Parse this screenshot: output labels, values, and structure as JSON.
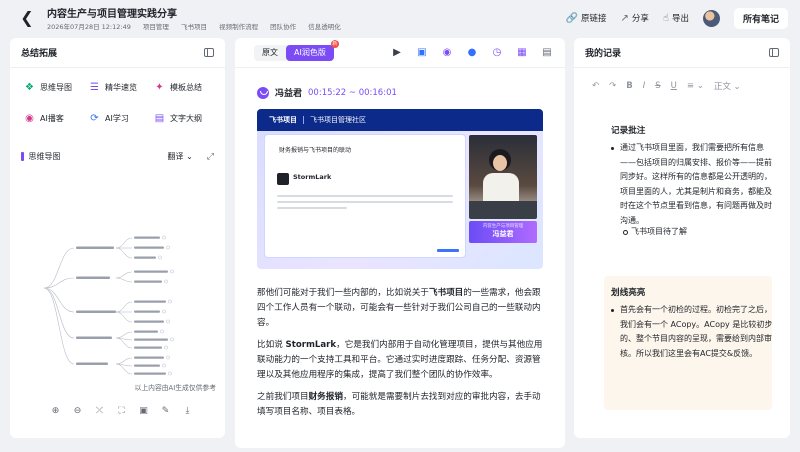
{
  "header": {
    "back_icon": "chevron-left-icon",
    "title": "内容生产与项目管理实践分享",
    "date": "2026年07月28日 12:12:49",
    "tags": [
      "项目管理",
      "飞书项目",
      "视频制作流程",
      "团队协作",
      "信息透明化"
    ],
    "actions": {
      "original_link": "原链接",
      "share": "分享",
      "export": "导出",
      "all_notes": "所有笔记"
    }
  },
  "left_panel": {
    "title": "总结拓展",
    "tools": [
      {
        "label": "思维导图",
        "icon": "mindmap-icon",
        "color": "#00a870"
      },
      {
        "label": "精华速览",
        "icon": "highlights-icon",
        "color": "#7b4cf6"
      },
      {
        "label": "模板总结",
        "icon": "template-icon",
        "color": "#d4368a"
      },
      {
        "label": "AI播客",
        "icon": "podcast-icon",
        "color": "#d4368a"
      },
      {
        "label": "AI学习",
        "icon": "ai-learn-icon",
        "color": "#3370ff"
      },
      {
        "label": "文字大纲",
        "icon": "outline-icon",
        "color": "#7b4cf6"
      }
    ],
    "mindmap": {
      "title": "思维导图",
      "translate": "翻译",
      "caption": "以上内容由AI生成仅供参考"
    }
  },
  "middle_panel": {
    "tabs": {
      "original": "原文",
      "ai_polished": "AI润色版",
      "badge": "新"
    },
    "speaker": {
      "name": "冯益君",
      "time": "00:15:22 ~ 00:16:01"
    },
    "video": {
      "logo": "飞书项目",
      "community": "飞书项目管理社区",
      "slide_title": "财务报销与飞书项目的联动",
      "slide_brand": "StormLark",
      "name_card_sub": "内容生产与项目管理",
      "name_card_name": "冯益君"
    },
    "transcript": [
      {
        "pre": "那他们可能对于我们一些内部的，比如说关于",
        "bold": "飞书项目",
        "post": "的一些需求，他会跟四个工作人员有一个联动，可能会有一些针对于我们公司自己的一些联动内容。"
      },
      {
        "pre": "比如说 ",
        "bold": "StormLark",
        "post": "，它是我们内部用于自动化管理项目，提供与其他应用联动能力的一个支持工具和平台。它通过实时进度跟踪、任务分配、资源管理以及其他应用程序的集成，提高了我们整个团队的协作效率。"
      },
      {
        "pre": "之前我们项目",
        "bold": "财务报销",
        "post": "，可能就是需要制片去找到对应的审批内容，去手动填写项目名称、项目表格。"
      }
    ]
  },
  "right_panel": {
    "title": "我的记录",
    "toolbar": {
      "undo": "↶",
      "redo": "↷",
      "bold": "B",
      "italic": "I",
      "strike": "S",
      "underline": "U",
      "align": "≡",
      "style": "正文"
    },
    "notes_title": "记录批注",
    "notes_body": "通过飞书项目里面，我们需要把所有信息——包括项目的归属安排、报价等——提前同步好。这样所有的信息都是公开透明的，项目里面的人，尤其是制片和商务，都能及时在这个节点里看到信息，有问题再做及时沟通。",
    "notes_sub": "飞书项目待了解",
    "highlights_title": "划线亮亮",
    "highlights_body": "首先会有一个初检的过程。初检完了之后，我们会有一个 ACopy。ACopy 是比较初步的、整个节目内容的呈现，需要给到内部审核。所以我们这里会有AC提交&反馈。"
  }
}
